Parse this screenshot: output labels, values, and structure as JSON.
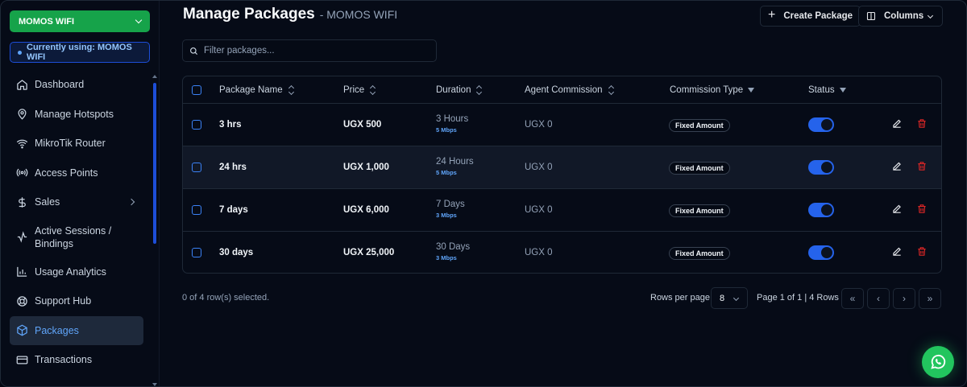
{
  "sidebar": {
    "org_name": "MOMOS WIFI",
    "current_label": "Currently using: MOMOS WIFI",
    "items": [
      {
        "label": "Dashboard",
        "icon": "home-icon"
      },
      {
        "label": "Manage Hotspots",
        "icon": "map-pin-icon"
      },
      {
        "label": "MikroTik Router",
        "icon": "wifi-icon"
      },
      {
        "label": "Access Points",
        "icon": "broadcast-icon"
      },
      {
        "label": "Sales",
        "icon": "dollar-icon"
      },
      {
        "label": "Active Sessions / Bindings",
        "icon": "activity-icon"
      },
      {
        "label": "Usage Analytics",
        "icon": "bar-chart-icon"
      },
      {
        "label": "Support Hub",
        "icon": "lifebuoy-icon"
      },
      {
        "label": "Packages",
        "icon": "package-icon"
      },
      {
        "label": "Transactions",
        "icon": "credit-card-icon"
      }
    ]
  },
  "header": {
    "title": "Manage Packages",
    "subtitle": "- MOMOS WIFI",
    "create_label": "Create Package",
    "columns_label": "Columns"
  },
  "filter": {
    "placeholder": "Filter packages..."
  },
  "table": {
    "columns": [
      "Package Name",
      "Price",
      "Duration",
      "Agent Commission",
      "Commission Type",
      "Status"
    ],
    "rows": [
      {
        "name": "3 hrs",
        "price": "UGX 500",
        "duration": "3 Hours",
        "speed": "5 Mbps",
        "commission": "UGX 0",
        "type": "Fixed Amount",
        "status": true
      },
      {
        "name": "24 hrs",
        "price": "UGX 1,000",
        "duration": "24 Hours",
        "speed": "5 Mbps",
        "commission": "UGX 0",
        "type": "Fixed Amount",
        "status": true
      },
      {
        "name": "7 days",
        "price": "UGX 6,000",
        "duration": "7 Days",
        "speed": "3 Mbps",
        "commission": "UGX 0",
        "type": "Fixed Amount",
        "status": true
      },
      {
        "name": "30 days",
        "price": "UGX 25,000",
        "duration": "30 Days",
        "speed": "3 Mbps",
        "commission": "UGX 0",
        "type": "Fixed Amount",
        "status": true
      }
    ]
  },
  "footer": {
    "selected": "0 of 4 row(s) selected.",
    "rows_per_page_label": "Rows per page",
    "rows_per_page": "8",
    "page_info": "Page 1 of 1 | 4 Rows",
    "first": "«",
    "prev": "‹",
    "next": "›",
    "last": "»"
  },
  "colors": {
    "accent": "#2563eb",
    "brand_green": "#16a34a",
    "danger": "#dc2626"
  }
}
